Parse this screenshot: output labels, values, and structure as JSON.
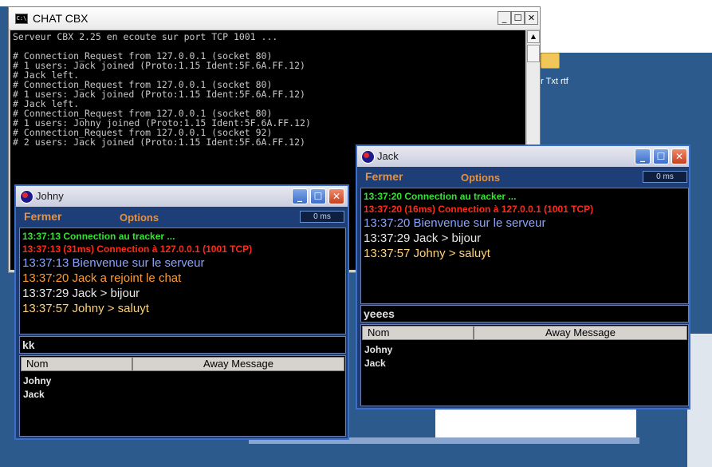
{
  "desktop": {
    "icon_labels": [
      "ur Txt rtf"
    ]
  },
  "console": {
    "title": "CHAT CBX",
    "lines": [
      "Serveur CBX 2.25 en ecoute sur port TCP 1001 ...",
      "",
      "# Connection_Request from 127.0.0.1 (socket 80)",
      "# 1 users: Jack joined (Proto:1.15 Ident:5F.6A.FF.12)",
      "# Jack left.",
      "# Connection_Request from 127.0.0.1 (socket 80)",
      "# 1 users: Jack joined (Proto:1.15 Ident:5F.6A.FF.12)",
      "# Jack left.",
      "# Connection_Request from 127.0.0.1 (socket 80)",
      "# 1 users: Johny joined (Proto:1.15 Ident:5F.6A.FF.12)",
      "# Connection_Request from 127.0.0.1 (socket 92)",
      "# 2 users: Jack joined (Proto:1.15 Ident:5F.6A.FF.12)"
    ],
    "btn_min": "_",
    "btn_max": "☐",
    "btn_close": "✕",
    "scroll_up": "▲"
  },
  "johny": {
    "title": "Johny",
    "menu_close": "Fermer",
    "menu_options": "Options",
    "ping": "0 ms",
    "messages": [
      {
        "text": "13:37:13 Connection au tracker ...",
        "color": "#33e233"
      },
      {
        "text": "13:37:13 (31ms) Connection à 127.0.0.1 (1001 TCP)",
        "color": "#ff2a1a"
      },
      {
        "text": "13:37:13 Bienvenue sur le serveur",
        "color": "#8aa4ff"
      },
      {
        "text": "13:37:20 Jack a rejoint le chat",
        "color": "#ff9a2e"
      },
      {
        "text": "13:37:29 Jack > bijour",
        "color": "#e8e8e8"
      },
      {
        "text": "13:37:57 Johny > saluyt",
        "color": "#ffd27a"
      }
    ],
    "input_value": "kk",
    "col_name": "Nom",
    "col_away": "Away Message",
    "users": [
      "Johny",
      "Jack"
    ]
  },
  "jack": {
    "title": "Jack",
    "menu_close": "Fermer",
    "menu_options": "Options",
    "ping": "0 ms",
    "messages": [
      {
        "text": "13:37:20 Connection au tracker ...",
        "color": "#33e233"
      },
      {
        "text": "13:37:20 (16ms) Connection à 127.0.0.1 (1001 TCP)",
        "color": "#ff2a1a"
      },
      {
        "text": "13:37:20 Bienvenue sur le serveur",
        "color": "#8aa4ff"
      },
      {
        "text": "13:37:29 Jack > bijour",
        "color": "#e8e8e8"
      },
      {
        "text": "13:37:57 Johny > saluyt",
        "color": "#ffd27a"
      }
    ],
    "input_value": "yeees",
    "col_name": "Nom",
    "col_away": "Away Message",
    "users": [
      "Johny",
      "Jack"
    ]
  }
}
